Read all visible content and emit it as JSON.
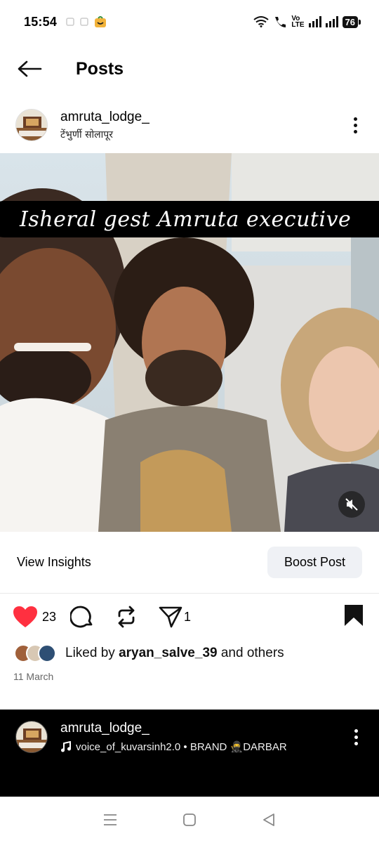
{
  "status": {
    "time": "15:54",
    "network": "LTE",
    "vo_label": "Vo",
    "lte_label": "LTE",
    "battery": "76"
  },
  "header": {
    "title": "Posts"
  },
  "post": {
    "username": "amruta_lodge_",
    "location": "टेंभुर्णी सोलापूर",
    "caption_overlay": "Isheral gest Amruta executive"
  },
  "insights": {
    "view_label": "View Insights",
    "boost_label": "Boost Post"
  },
  "actions": {
    "like_count": "23",
    "share_count": "1"
  },
  "liked_by": {
    "prefix": "Liked by",
    "user": "aryan_salve_39",
    "suffix": "and others"
  },
  "date": "11 March",
  "next_post": {
    "username": "amruta_lodge_",
    "audio": "voice_of_kuvarsinh2.0 • BRAND 🥷DARBAR"
  },
  "colors": {
    "like_red": "#ff3040",
    "accent_dark": "#000000",
    "boost_bg": "#eff1f5"
  }
}
